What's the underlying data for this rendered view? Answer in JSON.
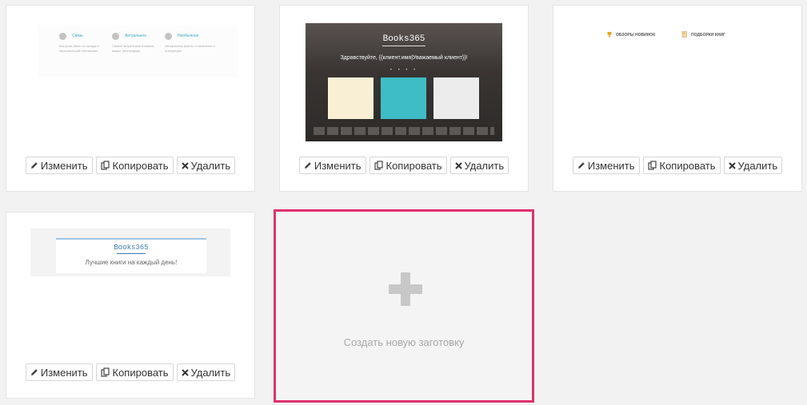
{
  "actions": {
    "edit": "Изменить",
    "copy": "Копировать",
    "delete": "Удалить"
  },
  "templates": [
    {
      "features": [
        {
          "title": "Связь",
          "desc": "Быстрая связь со склада в персональной обстановке"
        },
        {
          "title": "Актуальное",
          "desc": "Самые актуальные новинки, акции, распродажи"
        },
        {
          "title": "Необычное",
          "desc": "Интересные факты о писателях и литературе"
        }
      ]
    },
    {
      "logo": "Books365",
      "greeting": "Здравствуйте, {{клиент.имя|Уважаемый клиент}}!",
      "dots": "• • • •"
    },
    {
      "nav": [
        "ОБЗОРЫ НОВИНОК",
        "ПОДБОРКИ КНИГ"
      ]
    },
    {
      "logo": "Books365",
      "tagline": "Лучшие книги на каждый день!"
    }
  ],
  "create": {
    "label": "Создать новую заготовку"
  },
  "colors": {
    "accent": "#e0306e",
    "link": "#3aa8c9"
  }
}
